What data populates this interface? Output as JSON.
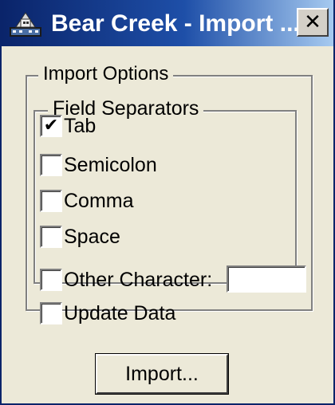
{
  "window": {
    "title": "Bear Creek - Import ...",
    "app_icon": "bear-creek-app-icon",
    "close_label": "✕",
    "close_icon": "close-icon"
  },
  "import_options": {
    "legend": "Import Options",
    "field_separators": {
      "legend": "Field Separators",
      "options": [
        {
          "label": "Tab",
          "checked": true
        },
        {
          "label": "Semicolon",
          "checked": false
        },
        {
          "label": "Comma",
          "checked": false
        },
        {
          "label": "Space",
          "checked": false
        },
        {
          "label": "Other Character:",
          "checked": false
        }
      ],
      "other_character_value": ""
    },
    "update_data": {
      "label": "Update Data",
      "checked": false
    }
  },
  "actions": {
    "import_label": "Import..."
  },
  "colors": {
    "titlebar_start": "#0a246a",
    "titlebar_end": "#a6caf0",
    "dialog_face": "#ece9d8"
  }
}
